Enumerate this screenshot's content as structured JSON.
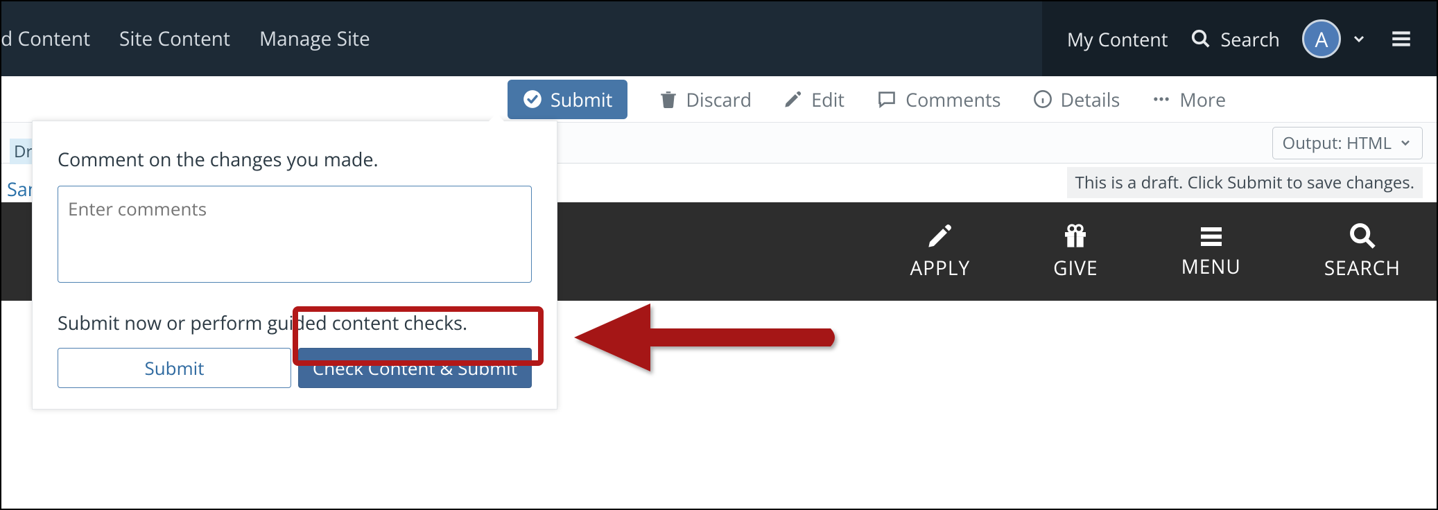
{
  "topnav_left": {
    "add_content": "dd Content",
    "site_content": "Site Content",
    "manage_site": "Manage Site"
  },
  "topnav_right": {
    "my_content": "My Content",
    "search_label": "Search",
    "avatar_initial": "A"
  },
  "actionbar": {
    "submit": "Submit",
    "discard": "Discard",
    "edit": "Edit",
    "comments": "Comments",
    "details": "Details",
    "more": "More"
  },
  "draft_tag": "Dra",
  "breadcrumb": "Sam",
  "output_label": "Output: HTML",
  "draft_notice": "This is a draft. Click Submit to save changes.",
  "banner": {
    "apply": "APPLY",
    "give": "GIVE",
    "menu": "MENU",
    "search": "SEARCH"
  },
  "popover": {
    "comment_label": "Comment on the changes you made.",
    "comment_placeholder": "Enter comments",
    "help_text": "Submit now or perform guided content checks.",
    "submit_btn": "Submit",
    "check_btn": "Check Content & Submit"
  }
}
